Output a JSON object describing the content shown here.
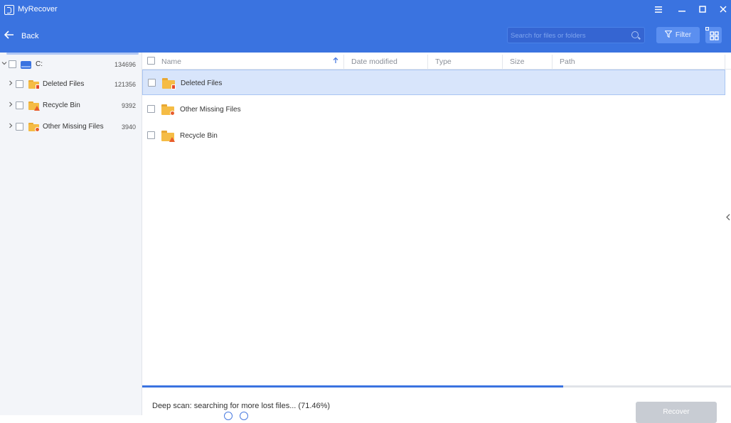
{
  "window": {
    "title": "MyRecover",
    "menu_icon": "hamburger-icon",
    "minimize_icon": "minimize-icon",
    "maximize_icon": "maximize-icon",
    "close_icon": "close-icon"
  },
  "toolbar": {
    "back_label": "Back",
    "search_placeholder": "Search for files or folders",
    "filter_label": "Filter"
  },
  "tree": {
    "root": {
      "label": "C:",
      "count": "134696"
    },
    "items": [
      {
        "label": "Deleted Files",
        "count": "121356"
      },
      {
        "label": "Recycle Bin",
        "count": "9392"
      },
      {
        "label": "Other Missing Files",
        "count": "3940"
      }
    ]
  },
  "table": {
    "columns": [
      "Name",
      "Date modified",
      "Type",
      "Size",
      "Path"
    ],
    "rows": [
      {
        "name": "Deleted Files",
        "selected": true
      },
      {
        "name": "Other Missing Files",
        "selected": false
      },
      {
        "name": "Recycle Bin",
        "selected": false
      }
    ]
  },
  "scan": {
    "status": "Deep scan: searching for more lost files... (71.46%)",
    "progress": 0.7146
  },
  "actions": {
    "recover_label": "Recover"
  },
  "colors": {
    "accent": "#3a73e0",
    "selected_row": "#d8e5fb",
    "disabled_button": "#c8ccd3"
  }
}
